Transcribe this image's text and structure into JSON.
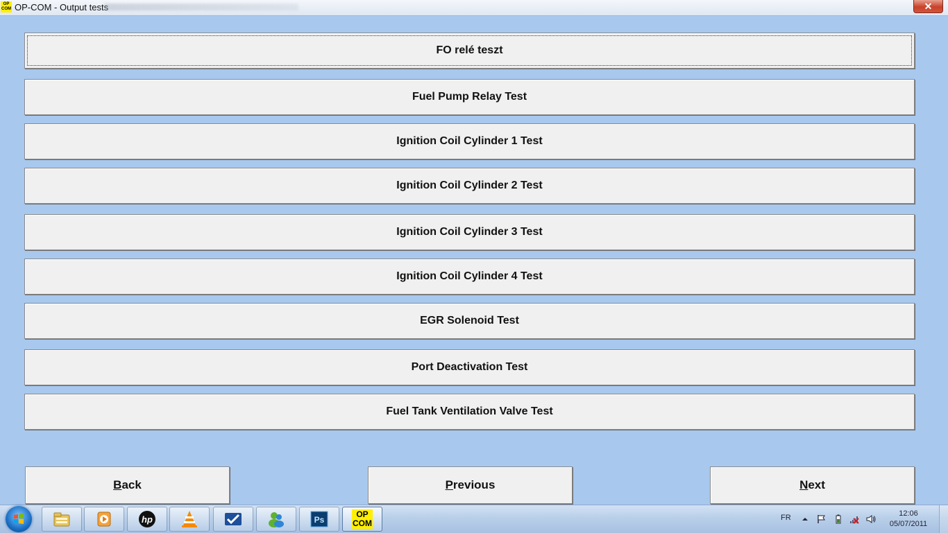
{
  "window": {
    "app_icon_text_1": "OP",
    "app_icon_text_2": "COM",
    "title": "OP-COM - Output tests",
    "close_label": "✕"
  },
  "tests": [
    {
      "label": "FO relé teszt",
      "focused": true
    },
    {
      "label": "Fuel Pump Relay Test"
    },
    {
      "label": "Ignition Coil Cylinder 1 Test"
    },
    {
      "label": "Ignition Coil Cylinder 2 Test"
    },
    {
      "label": "Ignition Coil Cylinder 3 Test"
    },
    {
      "label": "Ignition Coil Cylinder 4 Test"
    },
    {
      "label": "EGR Solenoid Test"
    },
    {
      "label": "Port Deactivation Test"
    },
    {
      "label": "Fuel Tank Ventilation Valve Test"
    }
  ],
  "nav": {
    "back": {
      "mnemonic": "B",
      "rest": "ack"
    },
    "previous": {
      "mnemonic": "P",
      "rest": "revious"
    },
    "next": {
      "mnemonic": "N",
      "rest": "ext"
    }
  },
  "taskbar": {
    "items": [
      "explorer-icon",
      "media-player-icon",
      "hp-icon",
      "vlc-icon",
      "checkmark-app-icon",
      "messenger-icon",
      "photoshop-icon",
      "opcom-icon"
    ],
    "photoshop_label": "Ps",
    "hp_label": "hp",
    "opcom_label_1": "OP",
    "opcom_label_2": "COM",
    "language": "FR",
    "time": "12:06",
    "date": "05/07/2011"
  },
  "colors": {
    "background": "#a8c8ee",
    "button_face": "#f0f0f0",
    "opcom_yellow": "#ffef00"
  }
}
